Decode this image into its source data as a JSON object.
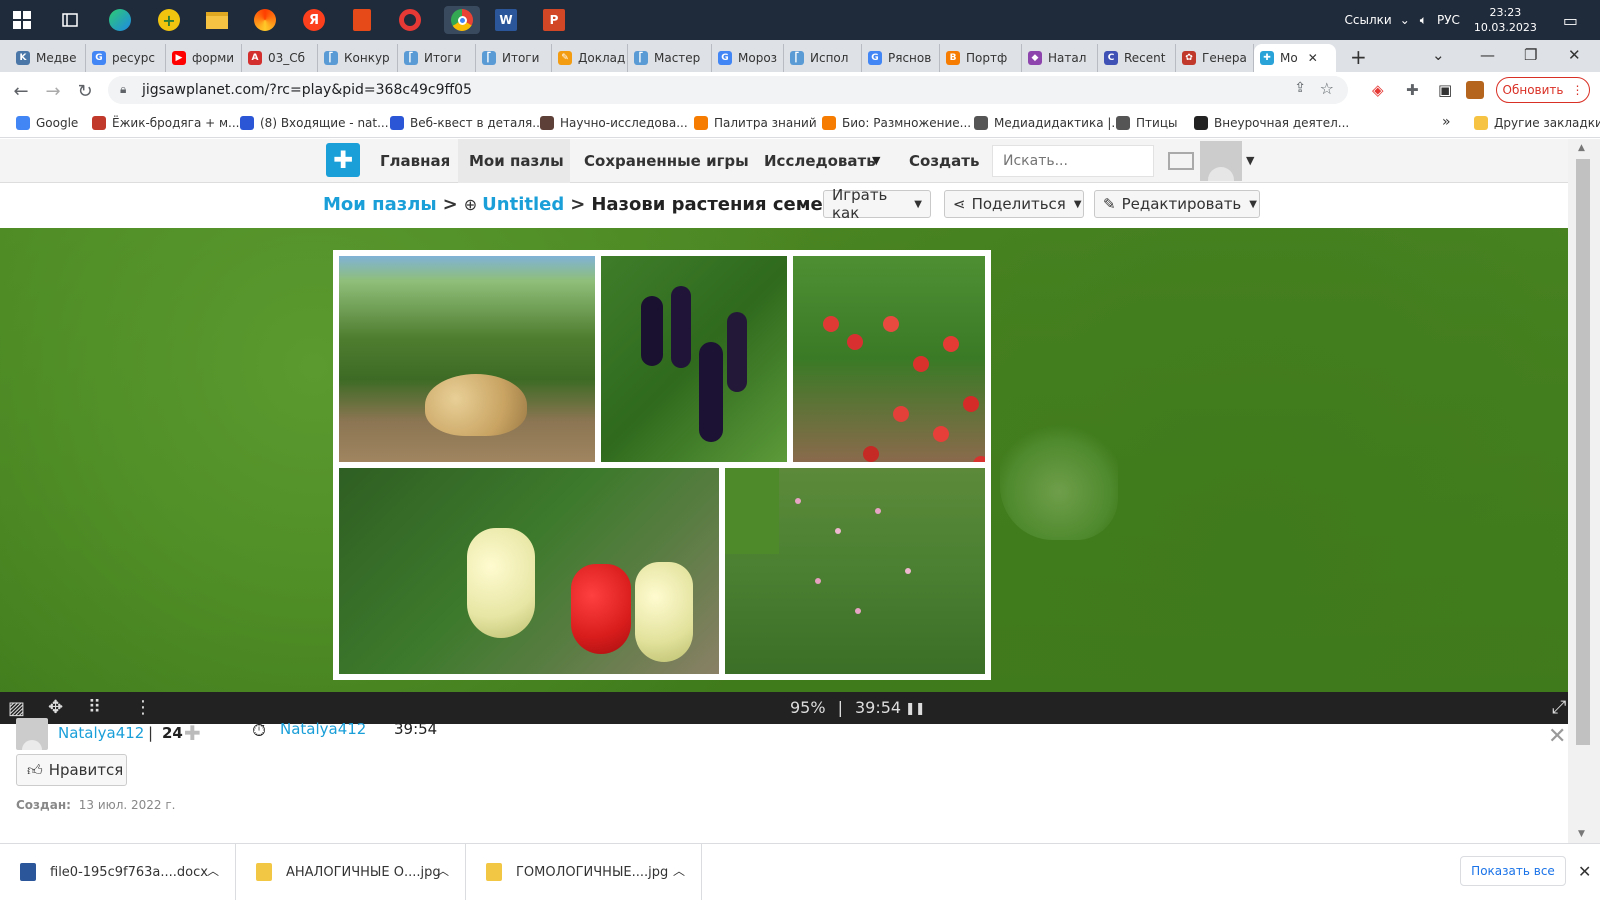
{
  "taskbar": {
    "right": {
      "links_label": "Ссылки",
      "lang": "РУС",
      "time": "23:23",
      "date": "10.03.2023"
    },
    "apps": [
      "start-icon",
      "task-view-icon",
      "edge-icon",
      "gaming-icon",
      "file-explorer-icon",
      "yandex-browser-icon",
      "yandex-icon",
      "office-icon",
      "opera-icon",
      "chrome-icon",
      "word-icon",
      "powerpoint-icon"
    ]
  },
  "tabs": [
    {
      "label": "Медве",
      "fav_color": "#4a76a8",
      "fav_letter": "K"
    },
    {
      "label": "ресурс",
      "fav_color": "#4285f4",
      "fav_letter": "G"
    },
    {
      "label": "форми",
      "fav_color": "#ff0000",
      "fav_letter": "▶"
    },
    {
      "label": "03_Сб",
      "fav_color": "#d32f2f",
      "fav_letter": "A"
    },
    {
      "label": "Конкур",
      "fav_color": "#5b9bd5",
      "fav_letter": "⎡"
    },
    {
      "label": "Итоги",
      "fav_color": "#5b9bd5",
      "fav_letter": "⎡"
    },
    {
      "label": "Итоги",
      "fav_color": "#5b9bd5",
      "fav_letter": "⎡"
    },
    {
      "label": "Доклад",
      "fav_color": "#f39c12",
      "fav_letter": "✎"
    },
    {
      "label": "Мастер",
      "fav_color": "#5b9bd5",
      "fav_letter": "⎡"
    },
    {
      "label": "Мороз",
      "fav_color": "#4285f4",
      "fav_letter": "G"
    },
    {
      "label": "Испол",
      "fav_color": "#5b9bd5",
      "fav_letter": "⎡"
    },
    {
      "label": "Ряснов",
      "fav_color": "#4285f4",
      "fav_letter": "G"
    },
    {
      "label": "Портф",
      "fav_color": "#f57c00",
      "fav_letter": "B"
    },
    {
      "label": "Натал",
      "fav_color": "#8e44ad",
      "fav_letter": "◆"
    },
    {
      "label": "Recent",
      "fav_color": "#3f51b5",
      "fav_letter": "C"
    },
    {
      "label": "Генера",
      "fav_color": "#c0392b",
      "fav_letter": "✿"
    },
    {
      "label": "Мо",
      "fav_color": "#2aa3d8",
      "fav_letter": "✚"
    }
  ],
  "address": {
    "url": "jigsawplanet.com/?rc=play&pid=368c49c9ff05",
    "update_label": "Обновить"
  },
  "bookmarks": [
    {
      "label": "Google",
      "color": "#4285f4"
    },
    {
      "label": "Ёжик-бродяга + м...",
      "color": "#c0392b"
    },
    {
      "label": "(8) Входящие - nat...",
      "color": "#2b57d6"
    },
    {
      "label": "Веб-квест в деталя...",
      "color": "#2b57d6"
    },
    {
      "label": "Научно-исследова...",
      "color": "#5d4037"
    },
    {
      "label": "Палитра знаний",
      "color": "#f57c00"
    },
    {
      "label": "Био: Размножение...",
      "color": "#f57c00"
    },
    {
      "label": "Медиадидактика |...",
      "color": "#555555"
    },
    {
      "label": "Птицы",
      "color": "#555555"
    },
    {
      "label": "Внеурочная деятел...",
      "color": "#222222"
    }
  ],
  "bookmarks_more": "»",
  "other_bookmarks": "Другие закладки",
  "site_nav": {
    "home": "Главная",
    "my_puzzles": "Мои пазлы",
    "saved_games": "Сохраненные игры",
    "explore": "Исследовать",
    "create": "Создать",
    "search_placeholder": "Искать..."
  },
  "breadcrumb": {
    "root": "Мои пазлы",
    "sep1": ">",
    "folder": "Untitled",
    "sep2": ">",
    "title": "Назови растения семей..."
  },
  "actions": {
    "play_as": "Играть как",
    "share": "Поделиться",
    "edit": "Редактировать"
  },
  "controls": {
    "percent": "95%",
    "separator": "|",
    "timer": "39:54"
  },
  "info": {
    "author": "Natalya412",
    "divider": "|",
    "pieces": "24",
    "record_user": "Natalya412",
    "record_time": "39:54",
    "like_label": "Нравится",
    "created_label": "Создан:",
    "created_date": "13 июл. 2022 г."
  },
  "downloads": [
    {
      "name": "file0-195c9f763a....docx",
      "icon_color": "#2b579a"
    },
    {
      "name": "АНАЛОГИЧНЫЕ О....jpg",
      "icon_color": "#f2c744"
    },
    {
      "name": "ГОМОЛОГИЧНЫЕ....jpg",
      "icon_color": "#f2c744"
    }
  ],
  "show_all_label": "Показать все",
  "colors": {
    "accent": "#1a9fd9",
    "stage_green": "#4f8a26",
    "update_red": "#d93025"
  }
}
